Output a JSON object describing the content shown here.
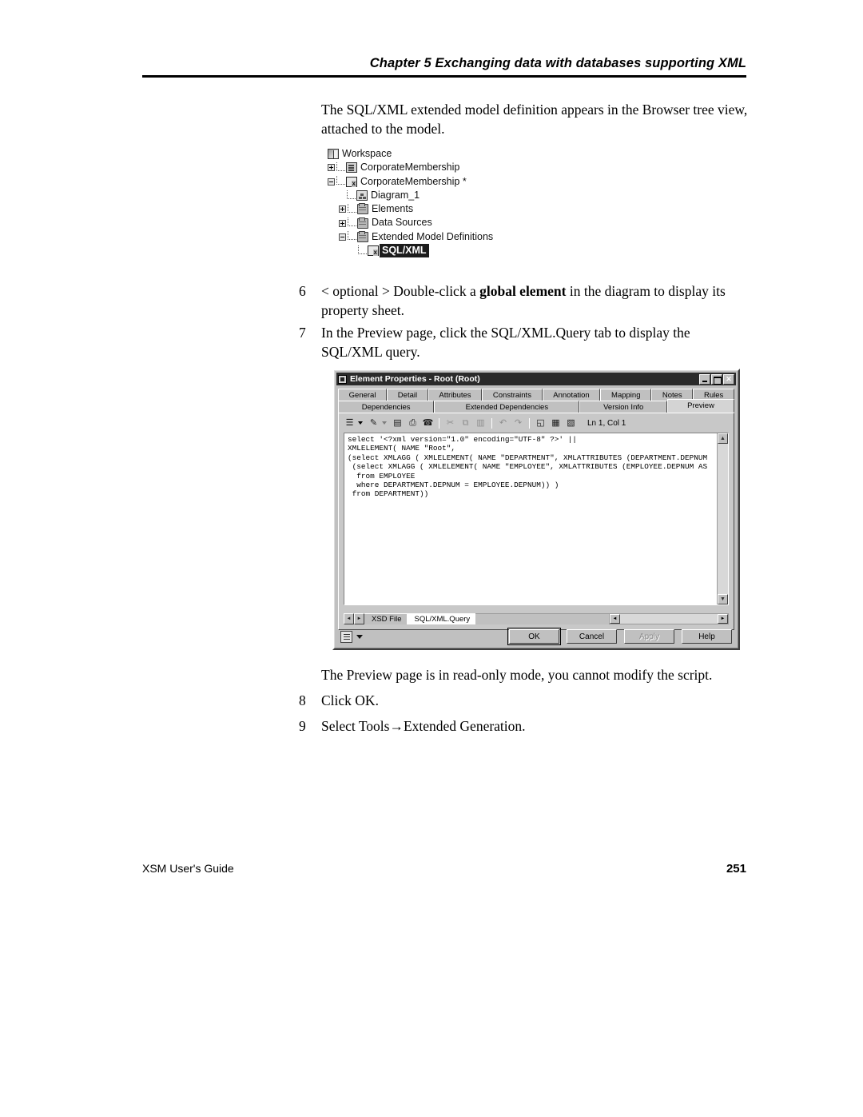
{
  "header": {
    "chapter": "Chapter 5",
    "title": "Exchanging data with databases supporting XML",
    "full": "Chapter 5    Exchanging data with databases supporting XML"
  },
  "intro_paragraph": "The SQL/XML extended model definition appears in the Browser tree view, attached to the model.",
  "tree": {
    "nodes": [
      {
        "label": "Workspace",
        "icon": "workspace-icon",
        "expander": "none",
        "selected": false
      },
      {
        "label": "CorporateMembership",
        "icon": "model-icon",
        "expander": "plus",
        "selected": false
      },
      {
        "label": "CorporateMembership *",
        "icon": "xml-model-icon",
        "expander": "minus",
        "selected": false
      },
      {
        "label": "Diagram_1",
        "icon": "diagram-icon",
        "expander": "none",
        "selected": false
      },
      {
        "label": "Elements",
        "icon": "folder-icon",
        "expander": "plus",
        "selected": false
      },
      {
        "label": "Data Sources",
        "icon": "folder-icon",
        "expander": "plus",
        "selected": false
      },
      {
        "label": "Extended Model Definitions",
        "icon": "folder-icon",
        "expander": "minus",
        "selected": false
      },
      {
        "label": "SQL/XML",
        "icon": "xml-def-icon",
        "expander": "none",
        "selected": true
      }
    ]
  },
  "steps": [
    {
      "number": "6",
      "pre": "< optional > Double-click a ",
      "bold": "global element",
      "post": " in the diagram to display its property sheet."
    },
    {
      "number": "7",
      "pre": "In the Preview page, click the SQL/XML.Query tab to display the SQL/XML query.",
      "bold": "",
      "post": ""
    },
    {
      "number": "8",
      "pre": "Click OK.",
      "bold": "",
      "post": ""
    },
    {
      "number": "9",
      "pre": "Select Tools→Extended Generation.",
      "bold": "",
      "post": ""
    }
  ],
  "note_paragraph": "The Preview page is in read-only mode, you cannot modify the script.",
  "dialog": {
    "title": "Element Properties - Root (Root)",
    "window_buttons": {
      "minimize": "minimize-button",
      "maximize": "maximize-button",
      "close": "✕"
    },
    "tabs_row1": [
      "General",
      "Detail",
      "Attributes",
      "Constraints",
      "Annotation",
      "Mapping",
      "Notes",
      "Rules"
    ],
    "tabs_row2": [
      "Dependencies",
      "Extended Dependencies",
      "Version Info",
      "Preview"
    ],
    "active_tab": "Preview",
    "toolbar": {
      "buttons": [
        {
          "name": "new-list-icon",
          "glyph": "☰",
          "dropdown": true,
          "disabled": false
        },
        {
          "name": "edit-properties-icon",
          "glyph": "✎",
          "dropdown": true,
          "disabled": false
        },
        {
          "name": "save-icon",
          "glyph": "▤",
          "dropdown": false,
          "disabled": false
        },
        {
          "name": "print-icon",
          "glyph": "⎙",
          "dropdown": false,
          "disabled": false
        },
        {
          "name": "find-icon",
          "glyph": "☎",
          "dropdown": false,
          "disabled": false
        },
        {
          "name": "cut-icon",
          "glyph": "✂",
          "dropdown": false,
          "disabled": true
        },
        {
          "name": "copy-icon",
          "glyph": "⧉",
          "dropdown": false,
          "disabled": true
        },
        {
          "name": "paste-icon",
          "glyph": "▥",
          "dropdown": false,
          "disabled": true
        },
        {
          "name": "undo-icon",
          "glyph": "↶",
          "dropdown": false,
          "disabled": true
        },
        {
          "name": "redo-icon",
          "glyph": "↷",
          "dropdown": false,
          "disabled": true
        },
        {
          "name": "open-editor-icon",
          "glyph": "◱",
          "dropdown": false,
          "disabled": false
        },
        {
          "name": "grid-icon",
          "glyph": "▦",
          "dropdown": false,
          "disabled": false
        },
        {
          "name": "edit-script-icon",
          "glyph": "▧",
          "dropdown": false,
          "disabled": false
        }
      ],
      "status": "Ln 1, Col 1"
    },
    "code": "select '<?xml version=\"1.0\" encoding=\"UTF-8\" ?>' ||\nXMLELEMENT( NAME \"Root\",\n(select XMLAGG ( XMLELEMENT( NAME \"DEPARTMENT\", XMLATTRIBUTES (DEPARTMENT.DEPNUM\n (select XMLAGG ( XMLELEMENT( NAME \"EMPLOYEE\", XMLATTRIBUTES (EMPLOYEE.DEPNUM AS\n  from EMPLOYEE\n  where DEPARTMENT.DEPNUM = EMPLOYEE.DEPNUM)) )\n from DEPARTMENT))",
    "scrollbar": {
      "up": "▲",
      "down": "▼",
      "left": "◄",
      "right": "►"
    },
    "sheet_tabs": [
      "XSD File",
      "SQL/XML.Query"
    ],
    "active_sheet_tab": "SQL/XML.Query",
    "buttons": [
      {
        "label": "OK",
        "default": true,
        "disabled": false
      },
      {
        "label": "Cancel",
        "default": false,
        "disabled": false
      },
      {
        "label": "Apply",
        "default": false,
        "disabled": true
      },
      {
        "label": "Help",
        "default": false,
        "disabled": false
      }
    ]
  },
  "footer": {
    "guide": "XSM User's Guide",
    "page": "251"
  }
}
